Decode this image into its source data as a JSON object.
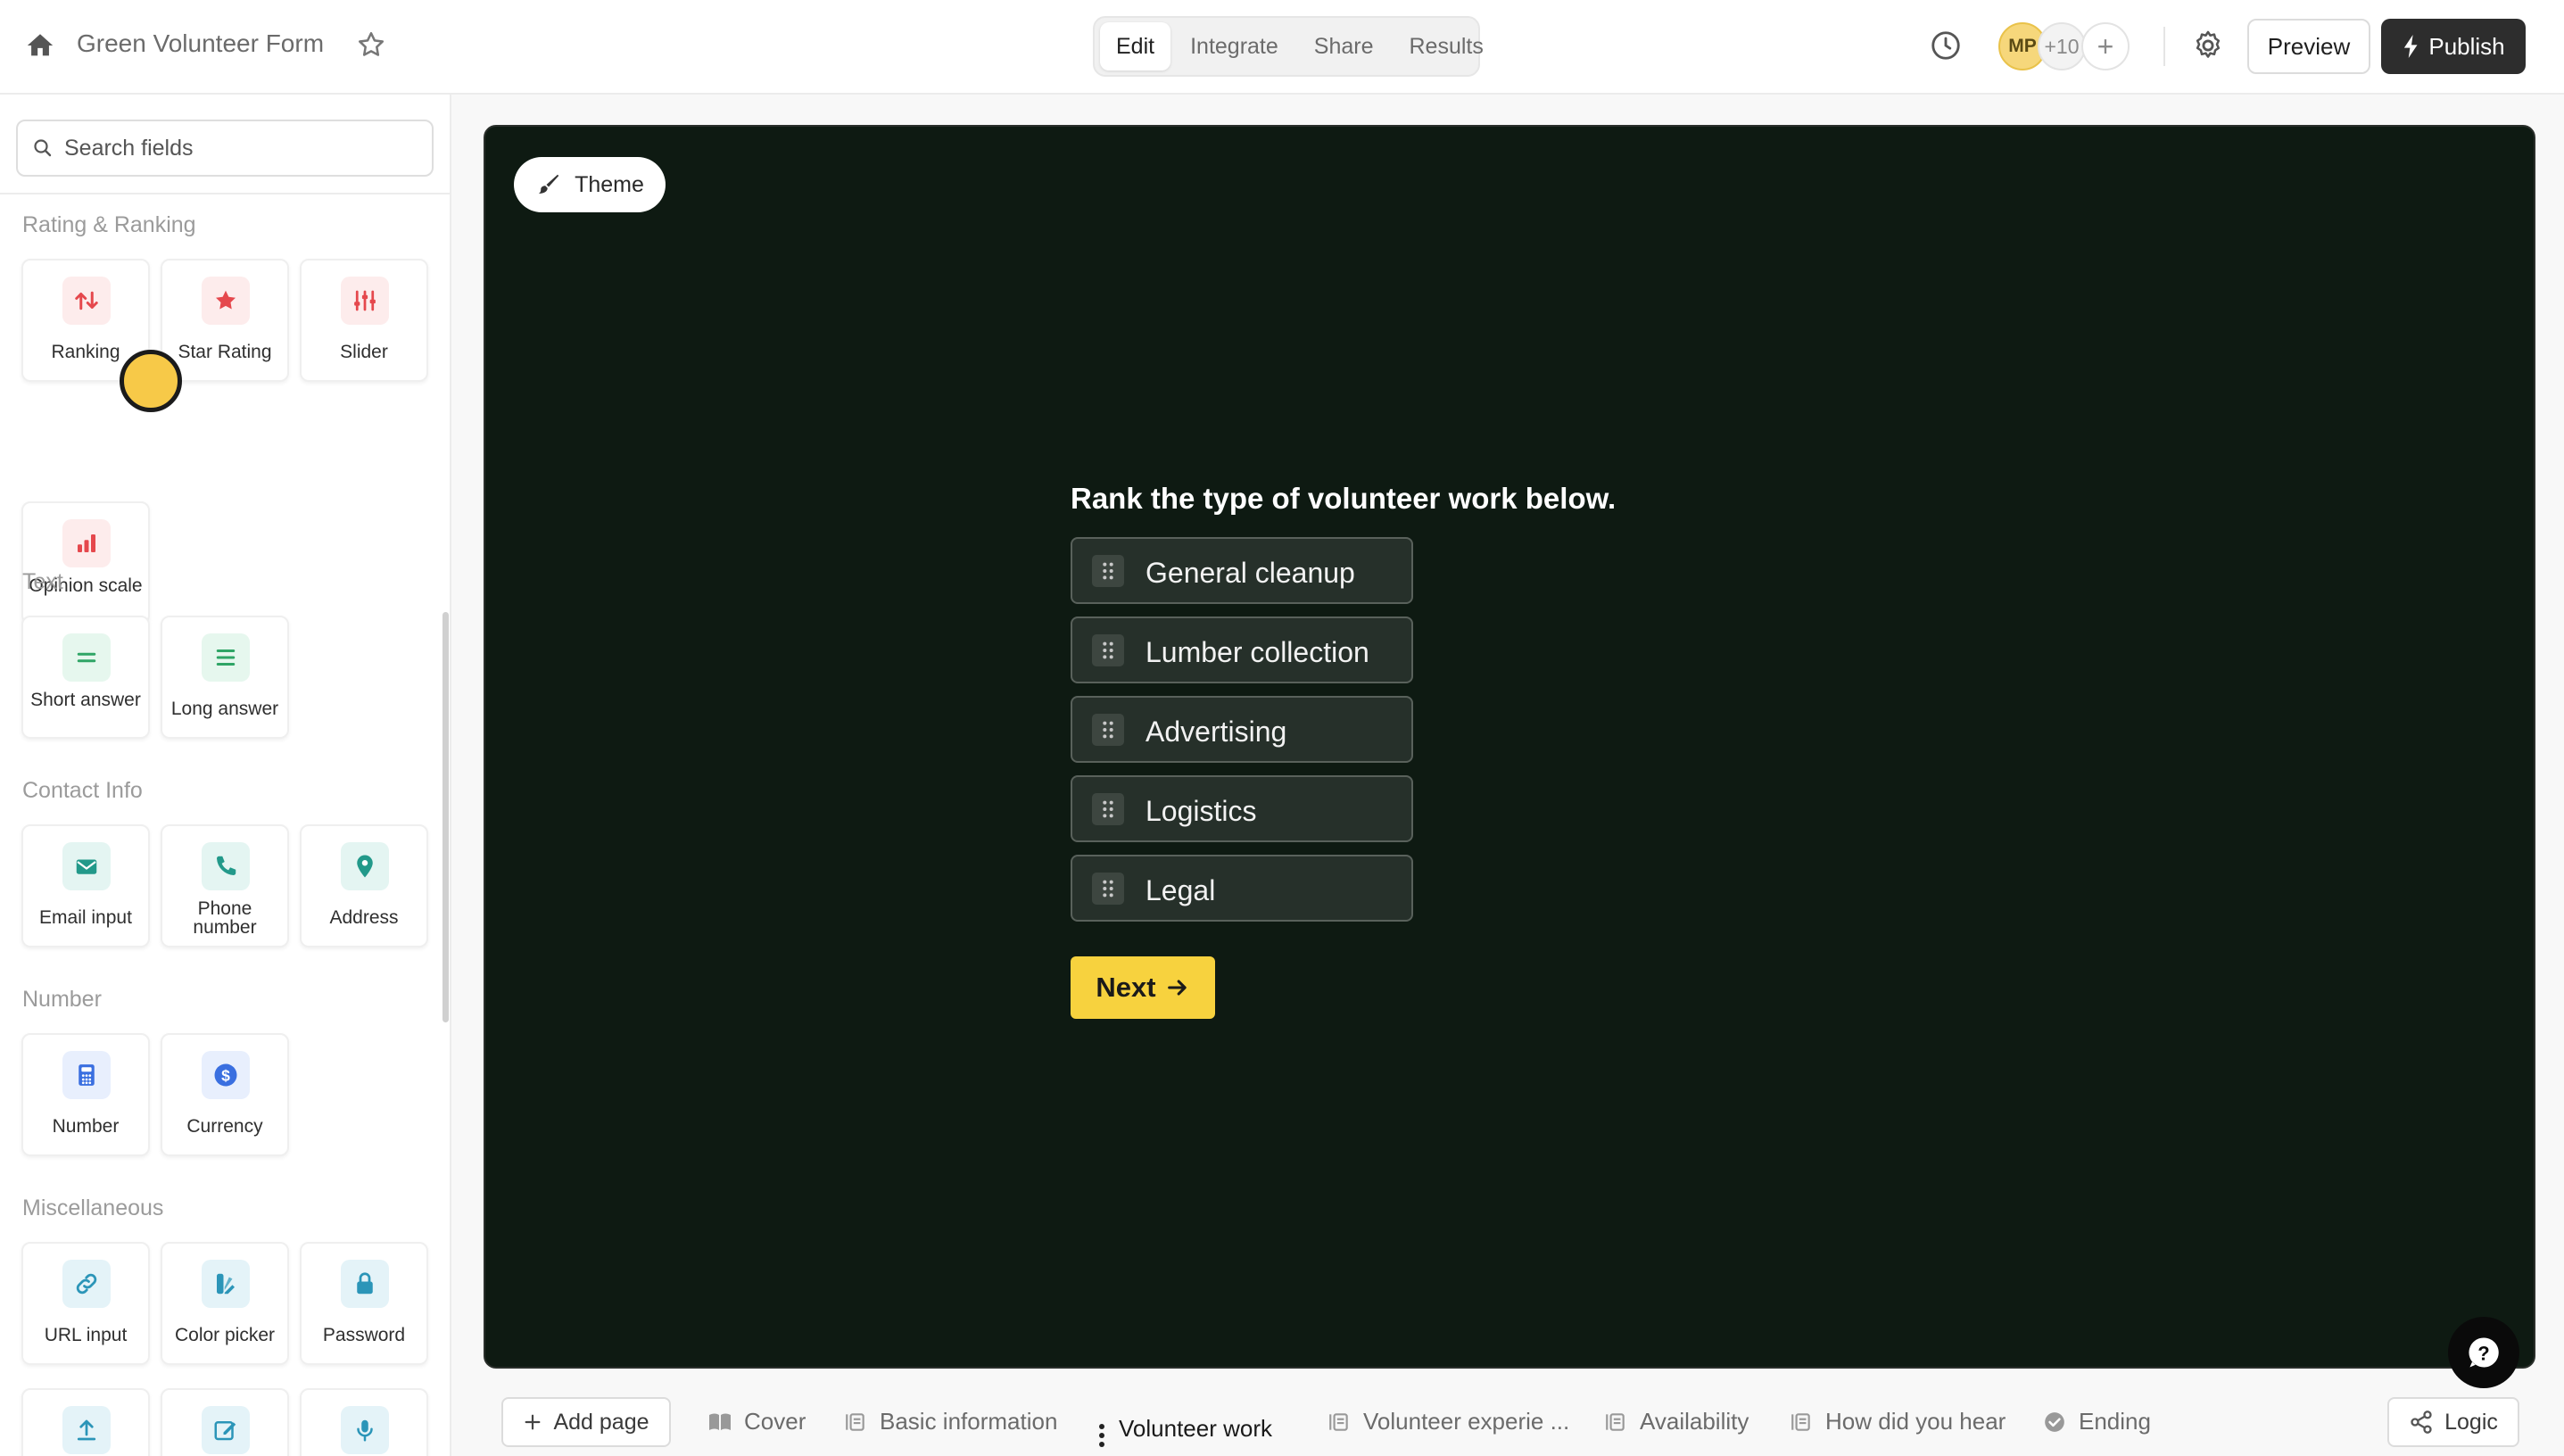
{
  "app": {
    "title": "Green Volunteer Form"
  },
  "nav": {
    "tabs": [
      {
        "label": "Edit",
        "active": true
      },
      {
        "label": "Integrate"
      },
      {
        "label": "Share"
      },
      {
        "label": "Results"
      }
    ]
  },
  "collaborators": {
    "initials": "MP",
    "extra": "+10",
    "add": "+"
  },
  "toolbar": {
    "preview_label": "Preview",
    "publish_label": "Publish"
  },
  "sidebar": {
    "search_placeholder": "Search fields",
    "sections": {
      "rating": {
        "label": "Rating & Ranking",
        "items": [
          "Ranking",
          "Star Rating",
          "Slider",
          "Opinion scale"
        ]
      },
      "text": {
        "label": "Text",
        "items": [
          "Short answer",
          "Long answer"
        ]
      },
      "contact": {
        "label": "Contact Info",
        "items": [
          "Email input",
          "Phone number",
          "Address"
        ]
      },
      "number": {
        "label": "Number",
        "items": [
          "Number",
          "Currency"
        ]
      },
      "misc": {
        "label": "Miscellaneous",
        "items": [
          "URL input",
          "Color picker",
          "Password"
        ]
      }
    }
  },
  "canvas": {
    "theme_label": "Theme",
    "question": "Rank the type of volunteer work below.",
    "options": [
      "General cleanup",
      "Lumber collection",
      "Advertising",
      "Logistics",
      "Legal"
    ],
    "next_label": "Next",
    "background_color": "#0e1a12",
    "accent_color": "#f7d23e"
  },
  "pages": {
    "add_label": "Add page",
    "tabs": [
      {
        "label": "Cover"
      },
      {
        "label": "Basic information"
      },
      {
        "label": "Volunteer work",
        "active": true
      },
      {
        "label": "Volunteer experie ..."
      },
      {
        "label": "Availability"
      },
      {
        "label": "How did you hear"
      },
      {
        "label": "Ending"
      }
    ],
    "logic_label": "Logic"
  }
}
